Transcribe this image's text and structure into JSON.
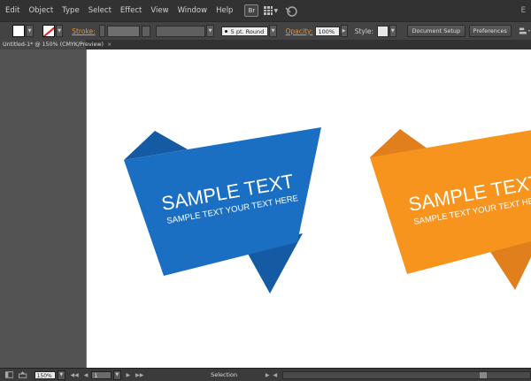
{
  "menubar": {
    "items": [
      "Edit",
      "Object",
      "Type",
      "Select",
      "Effect",
      "View",
      "Window",
      "Help"
    ],
    "bridge_label": "Br",
    "right_text": "E"
  },
  "controlbar": {
    "stroke_label": "Stroke:",
    "brush_value": "5 pt. Round",
    "opacity_label": "Opacity:",
    "opacity_value": "100%",
    "style_label": "Style:",
    "document_setup": "Document Setup",
    "preferences": "Preferences"
  },
  "tab": {
    "title": "Untitled-1* @ 150% (CMYK/Preview)",
    "close": "×"
  },
  "artwork": {
    "blue_banner": {
      "title": "SAMPLE TEXT",
      "subtitle": "SAMPLE TEXT YOUR TEXT HERE",
      "main_color": "#1a6fc3",
      "dark_color": "#155ba3",
      "fold_color": "#124e8e"
    },
    "orange_banner": {
      "title": "SAMPLE TEXT",
      "subtitle": "SAMPLE TEXT YOUR TEXT HERE",
      "main_color": "#f7941d",
      "dark_color": "#e07f1c",
      "fold_color": "#d4761a"
    }
  },
  "statusbar": {
    "zoom_value": "150%",
    "page_value": "1",
    "status_text": "Selection"
  },
  "colors": {
    "accent_link": "#e8963a",
    "menubar_bg": "#323232",
    "workspace_bg": "#535353"
  }
}
